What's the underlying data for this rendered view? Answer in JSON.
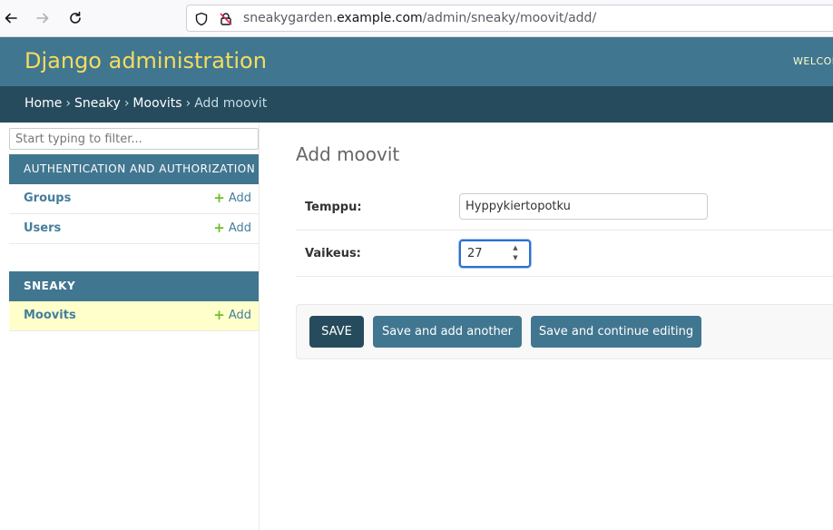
{
  "browser": {
    "url_prefix": "sneakygarden.",
    "url_domain": "example.com",
    "url_path": "/admin/sneaky/moovit/add/"
  },
  "header": {
    "branding": "Django administration",
    "user_tools": "WELCOM"
  },
  "breadcrumbs": {
    "home": "Home",
    "app": "Sneaky",
    "model": "Moovits",
    "current": "Add moovit",
    "separator": "›"
  },
  "sidebar": {
    "filter_placeholder": "Start typing to filter...",
    "modules": [
      {
        "caption": "AUTHENTICATION AND AUTHORIZATION",
        "rows": [
          {
            "label": "Groups",
            "add": "Add"
          },
          {
            "label": "Users",
            "add": "Add"
          }
        ]
      },
      {
        "caption": "SNEAKY",
        "rows": [
          {
            "label": "Moovits",
            "add": "Add"
          }
        ]
      }
    ],
    "collapse_glyph": "«"
  },
  "content": {
    "title": "Add moovit",
    "fields": {
      "temppu": {
        "label": "Temppu:",
        "value": "Hyppykiertopotku"
      },
      "vaikeus": {
        "label": "Vaikeus:",
        "value": "27"
      }
    },
    "buttons": {
      "save": "SAVE",
      "save_add_another": "Save and add another",
      "save_continue": "Save and continue editing"
    }
  },
  "colors": {
    "header_bg": "#417690",
    "breadcrumbs_bg": "#264b5d",
    "branding": "#f5dd5d",
    "link": "#447e9b",
    "current_row": "#ffffcc",
    "add_icon": "#70bf2b"
  }
}
